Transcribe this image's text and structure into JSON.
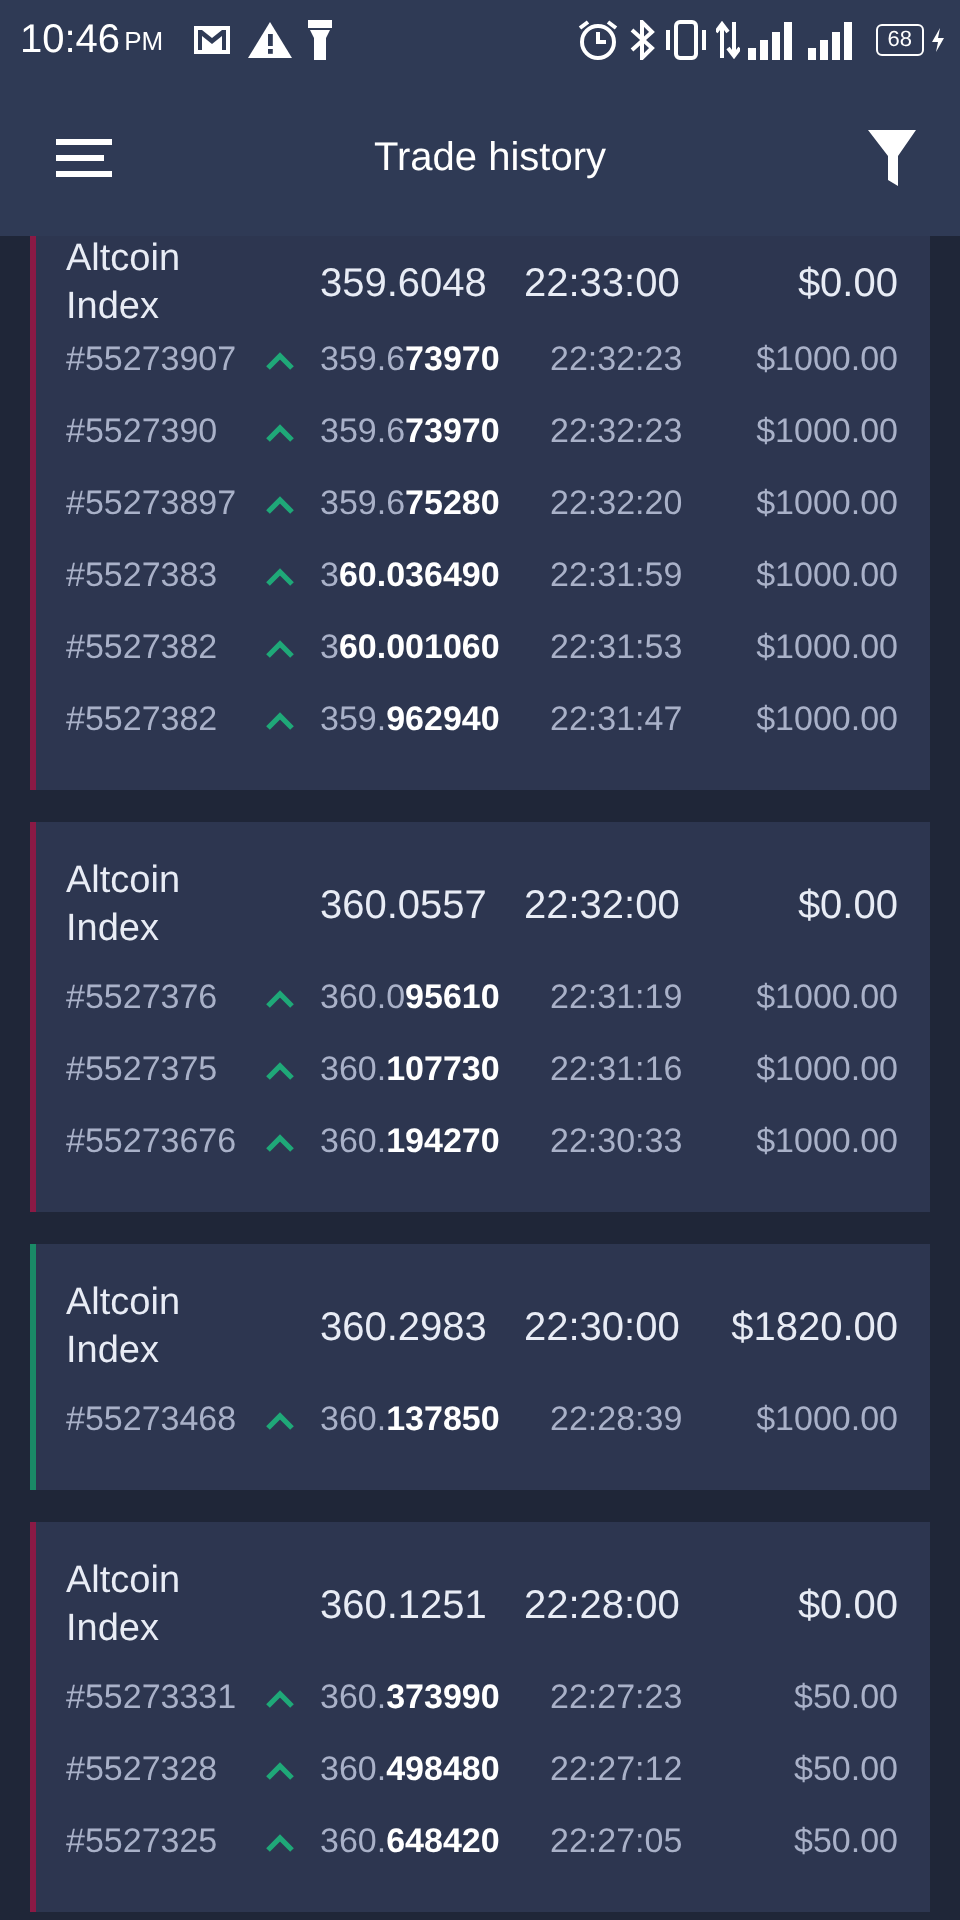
{
  "status_bar": {
    "time": "10:46",
    "ampm": "PM",
    "battery": "68"
  },
  "app_bar": {
    "title": "Trade history"
  },
  "trades": [
    {
      "color": "#8a1a45",
      "asset": "Altcoin Index",
      "price": "359.6048",
      "time": "22:33:00",
      "payout": "$0.00",
      "top_cut": true,
      "orders": [
        {
          "id": "#55273907",
          "kind": "up",
          "price": "359.6**73970**",
          "time": "22:32:23",
          "amount": "$1000.00"
        },
        {
          "id": "#5527390",
          "kind": "up",
          "price": "359.6**73970**",
          "time": "22:32:23",
          "amount": "$1000.00"
        },
        {
          "id": "#55273897",
          "kind": "up",
          "price": "359.6**75280**",
          "time": "22:32:20",
          "amount": "$1000.00"
        },
        {
          "id": "#5527383",
          "kind": "up",
          "price": "3**60.036490**",
          "time": "22:31:59",
          "amount": "$1000.00"
        },
        {
          "id": "#5527382",
          "kind": "up",
          "price": "3**60.001060**",
          "time": "22:31:53",
          "amount": "$1000.00"
        },
        {
          "id": "#5527382",
          "kind": "up",
          "price": "359.**962940**",
          "time": "22:31:47",
          "amount": "$1000.00"
        }
      ]
    },
    {
      "color": "#8a1a45",
      "asset": "Altcoin Index",
      "price": "360.0557",
      "time": "22:32:00",
      "payout": "$0.00",
      "top_cut": false,
      "orders": [
        {
          "id": "#5527376",
          "kind": "up",
          "price": "360.0**95610**",
          "time": "22:31:19",
          "amount": "$1000.00"
        },
        {
          "id": "#5527375",
          "kind": "up",
          "price": "360.**107730**",
          "time": "22:31:16",
          "amount": "$1000.00"
        },
        {
          "id": "#55273676",
          "kind": "up",
          "price": "360.**194270**",
          "time": "22:30:33",
          "amount": "$1000.00"
        }
      ]
    },
    {
      "color": "#1a8a66",
      "asset": "Altcoin Index",
      "price": "360.2983",
      "time": "22:30:00",
      "payout": "$1820.00",
      "top_cut": false,
      "orders": [
        {
          "id": "#55273468",
          "kind": "up",
          "price": "360.**137850**",
          "time": "22:28:39",
          "amount": "$1000.00"
        }
      ]
    },
    {
      "color": "#8a1a45",
      "asset": "Altcoin Index",
      "price": "360.1251",
      "time": "22:28:00",
      "payout": "$0.00",
      "top_cut": false,
      "orders": [
        {
          "id": "#55273331",
          "kind": "up",
          "price": "360.**373990**",
          "time": "22:27:23",
          "amount": "$50.00"
        },
        {
          "id": "#5527328",
          "kind": "up",
          "price": "360.**498480**",
          "time": "22:27:12",
          "amount": "$50.00"
        },
        {
          "id": "#5527325",
          "kind": "up",
          "price": "360.**648420**",
          "time": "22:27:05",
          "amount": "$50.00"
        }
      ]
    }
  ]
}
